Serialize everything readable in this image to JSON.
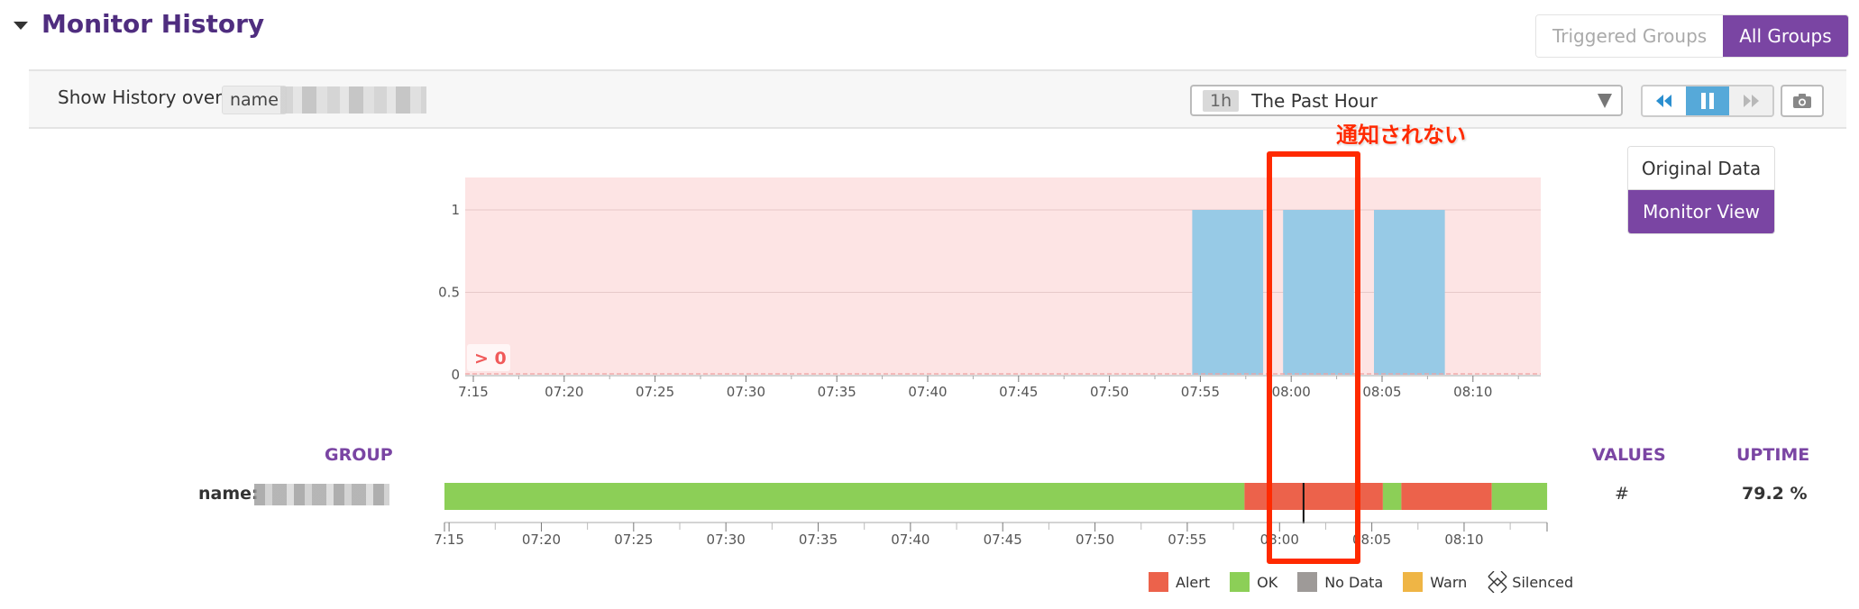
{
  "header": {
    "title": "Monitor History",
    "group_toggle": [
      {
        "label": "Triggered Groups",
        "active": false
      },
      {
        "label": "All Groups",
        "active": true
      }
    ]
  },
  "toolbar": {
    "show_history_label": "Show History over",
    "scope_tag": "name",
    "time_range_badge": "1h",
    "time_range_value": "The Past Hour",
    "nav_buttons": [
      "rewind-icon",
      "pause-icon",
      "fast-forward-icon"
    ],
    "camera_icon": "camera-icon"
  },
  "view_toggle": [
    {
      "label": "Original Data",
      "active": false
    },
    {
      "label": "Monitor View",
      "active": true
    }
  ],
  "annotation": {
    "text": "通知されない",
    "color": "#ff2a00"
  },
  "colors": {
    "brand_purple": "#7a45a3",
    "title_purple": "#4f2d7f",
    "alert": "#ec624b",
    "ok": "#8ccf57",
    "no_data": "#9e9a98",
    "warn": "#efb545",
    "bar_blue": "#97cae6",
    "threshold_fill": "#fde4e4",
    "threshold_label": "#f05a5a"
  },
  "chart_data": [
    {
      "type": "bar",
      "title": "",
      "xlabel": "",
      "ylabel": "",
      "x_range": [
        "07:15",
        "08:14"
      ],
      "ylim": [
        0,
        1.2
      ],
      "y_ticks": [
        "0",
        "0.5",
        "1"
      ],
      "x_ticks": [
        "7:15",
        "07:20",
        "07:25",
        "07:30",
        "07:35",
        "07:40",
        "07:45",
        "07:50",
        "07:55",
        "08:00",
        "08:05",
        "08:10"
      ],
      "grid": true,
      "threshold": {
        "label": "> 0",
        "value": 0
      },
      "bars": [
        {
          "start": "07:55",
          "end": "07:59",
          "value": 1
        },
        {
          "start": "08:00",
          "end": "08:04",
          "value": 1
        },
        {
          "start": "08:05",
          "end": "08:09",
          "value": 1
        }
      ]
    },
    {
      "type": "timeline",
      "group": "name:",
      "x_ticks": [
        "7:15",
        "07:20",
        "07:25",
        "07:30",
        "07:35",
        "07:40",
        "07:45",
        "07:50",
        "07:55",
        "08:00",
        "08:05",
        "08:10"
      ],
      "segments": [
        {
          "state": "OK",
          "start": "07:14.75",
          "end": "07:58.1"
        },
        {
          "state": "Alert",
          "start": "07:58.1",
          "end": "08:05.6"
        },
        {
          "state": "OK",
          "start": "08:05.6",
          "end": "08:06.6"
        },
        {
          "state": "Alert",
          "start": "08:06.6",
          "end": "08:11.5"
        },
        {
          "state": "OK",
          "start": "08:11.5",
          "end": "08:14.5"
        }
      ],
      "marker": "08:01.3"
    }
  ],
  "table": {
    "headers": {
      "group": "GROUP",
      "values": "VALUES",
      "uptime": "UPTIME"
    },
    "rows": [
      {
        "group": "name:",
        "value": "#",
        "uptime": "79.2 %"
      }
    ]
  },
  "legend": [
    {
      "label": "Alert",
      "color": "#ec624b"
    },
    {
      "label": "OK",
      "color": "#8ccf57"
    },
    {
      "label": "No Data",
      "color": "#9e9a98"
    },
    {
      "label": "Warn",
      "color": "#efb545"
    },
    {
      "label": "Silenced",
      "icon": "silenced-hatch-icon"
    }
  ]
}
